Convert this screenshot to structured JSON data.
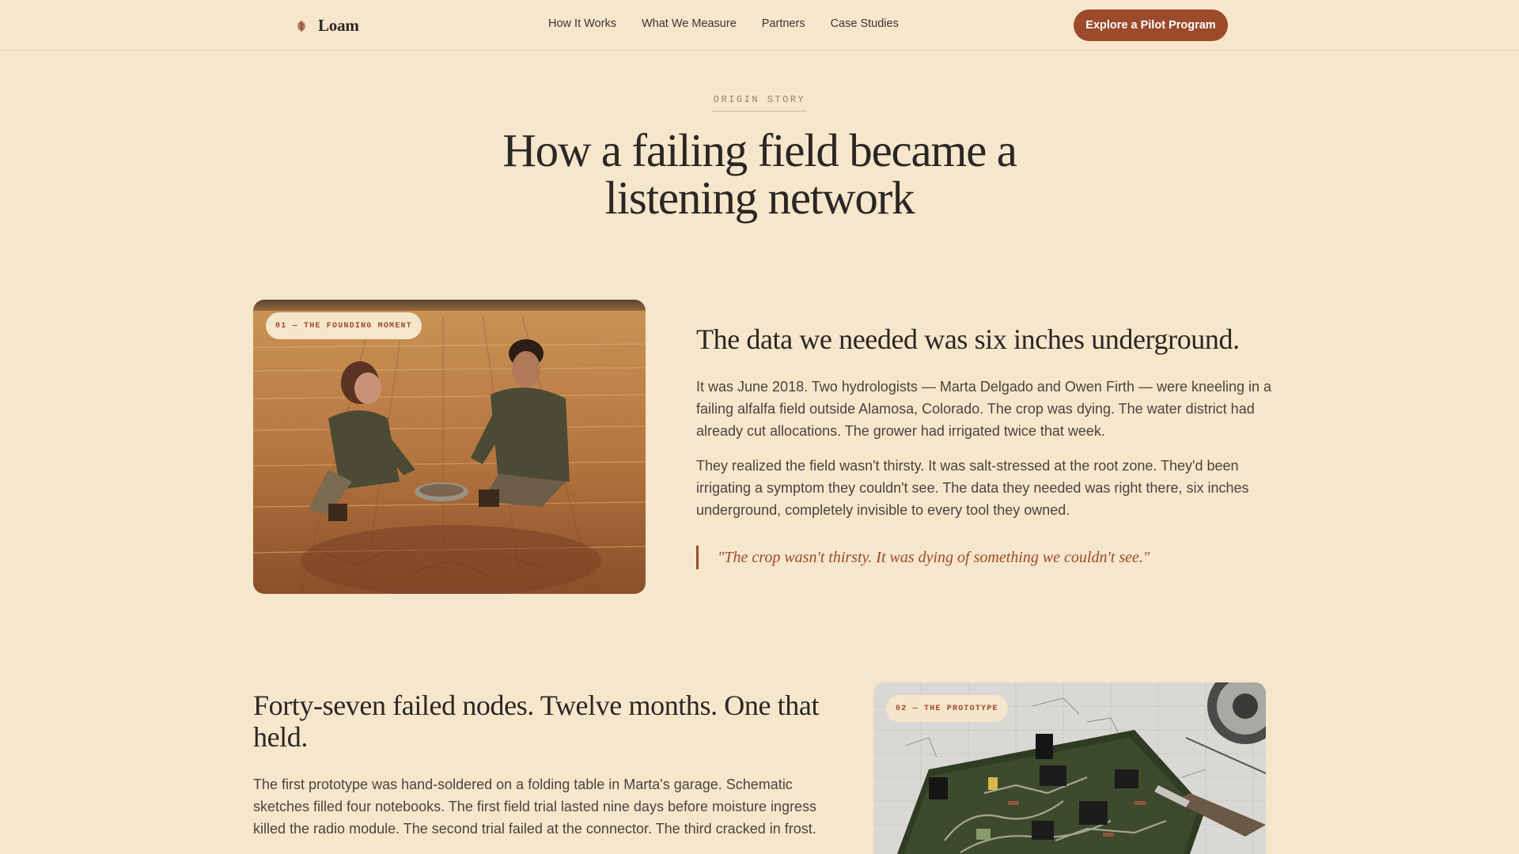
{
  "brand": {
    "name": "Loam",
    "logo_icon": "sprout-icon",
    "accent": "#9b4a2b"
  },
  "nav": {
    "links": [
      "How It Works",
      "What We Measure",
      "Partners",
      "Case Studies"
    ],
    "cta_label": "Explore a Pilot Program"
  },
  "hero": {
    "eyebrow": "ORIGIN STORY",
    "title": "How a failing field became a listening network"
  },
  "stories": [
    {
      "chip": "01 — THE FOUNDING MOMENT",
      "image": "two hydrologists kneeling in a dry alfalfa field",
      "headline": "The data we needed was six inches underground.",
      "paragraphs": [
        "It was June 2018. Two hydrologists — Marta Delgado and Owen Firth — were kneeling in a failing alfalfa field outside Alamosa, Colorado. The crop was dying. The water district had already cut allocations. The grower had irrigated twice that week.",
        "They realized the field wasn't thirsty. It was salt-stressed at the root zone. They'd been irrigating a symptom they couldn't see. The data they needed was right there, six inches underground, completely invisible to every tool they owned."
      ],
      "quote": "\"The crop wasn't thirsty. It was dying of something we couldn't see.\""
    },
    {
      "chip": "02 — THE PROTOTYPE",
      "image": "hand-soldered circuit board on schematic paper with soldering iron",
      "headline": "Forty-seven failed nodes. Twelve months. One that held.",
      "paragraphs": [
        "The first prototype was hand-soldered on a folding table in Marta's garage. Schematic sketches filled four notebooks. The first field trial lasted nine days before moisture ingress killed the radio module. The second trial failed at the connector. The third cracked in frost."
      ]
    }
  ]
}
